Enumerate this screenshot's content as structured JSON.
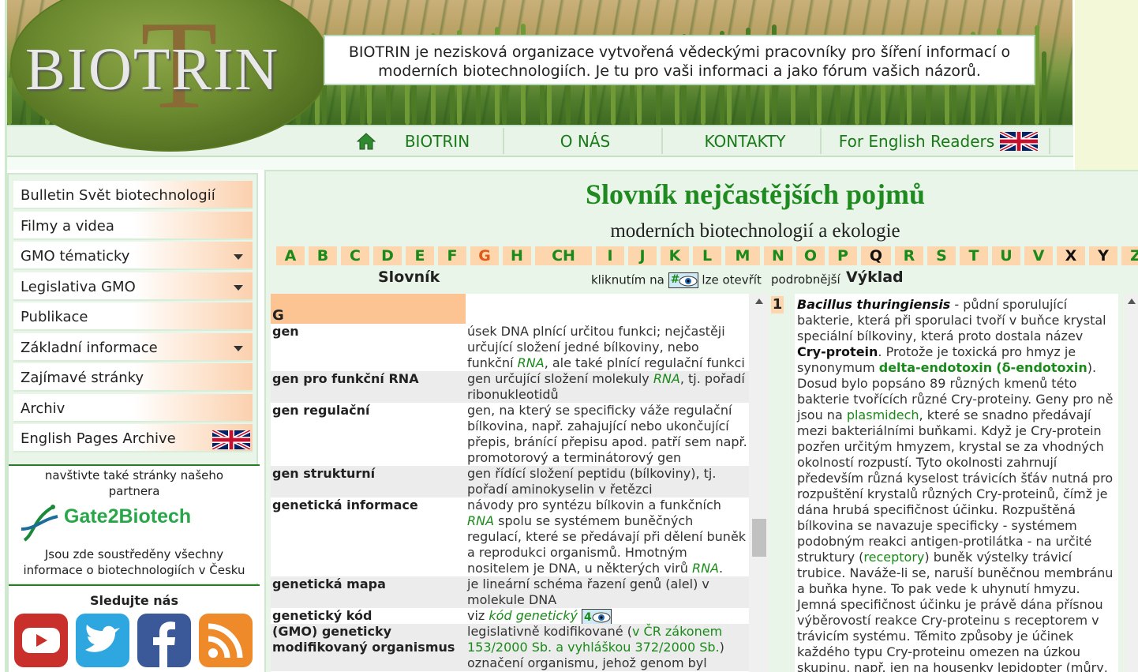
{
  "header": {
    "logo_text": "BIOTRIN",
    "intro": "BIOTRIN je nezisková organizace vytvořená vědeckými pracovníky pro šíření informací o moderních biotechnologiích. Je tu pro vaši informaci a jako fórum vašich názorů."
  },
  "nav": {
    "items": [
      {
        "label": "BIOTRIN",
        "icon": "home-icon"
      },
      {
        "label": "O NÁS"
      },
      {
        "label": "KONTAKTY"
      },
      {
        "label": "For English Readers",
        "icon": "uk-flag-icon"
      }
    ]
  },
  "sidebar": {
    "menu": [
      {
        "label": "Bulletin Svět biotechnologií",
        "has_submenu": false
      },
      {
        "label": "Filmy a videa",
        "has_submenu": false
      },
      {
        "label": "GMO tématicky",
        "has_submenu": true
      },
      {
        "label": "Legislativa GMO",
        "has_submenu": true
      },
      {
        "label": "Publikace",
        "has_submenu": false
      },
      {
        "label": "Základní informace",
        "has_submenu": true
      },
      {
        "label": "Zajímavé stránky",
        "has_submenu": false
      },
      {
        "label": "Archiv",
        "has_submenu": false
      },
      {
        "label": "English Pages Archive",
        "has_submenu": false,
        "icon": "uk-flag-icon"
      }
    ],
    "partner": {
      "intro": "navštivte také stránky našeho partnera",
      "logo_text": "Gate2Biotech",
      "outro": "Jsou zde soustředěny všechny informace o biotechnologiích v Česku"
    },
    "social": {
      "title": "Sledujte nás",
      "icons": [
        "youtube-icon",
        "twitter-icon",
        "facebook-icon",
        "rss-icon"
      ]
    }
  },
  "main": {
    "title": "Slovník nejčastějších pojmů",
    "subtitle": "moderních biotechnologií a ekologie",
    "alphabet": [
      "A",
      "B",
      "C",
      "D",
      "E",
      "F",
      "G",
      "H",
      "CH",
      "I",
      "J",
      "K",
      "L",
      "M",
      "N",
      "O",
      "P",
      "Q",
      "R",
      "S",
      "T",
      "U",
      "V",
      "X",
      "Y",
      "Z"
    ],
    "current_letter": "G",
    "dark_letters": [
      "Q",
      "X",
      "Y"
    ],
    "col_slovnik": "Slovník",
    "hint_pre": "kliknutím na",
    "hint_badge": "#",
    "hint_post": "lze otevřít",
    "hint_more": "podrobnější",
    "col_vyklad": "Výklad",
    "section_letter": "G",
    "entries": [
      {
        "term": "gen",
        "def": [
          "úsek DNA plnící určitou funkci; nejčastěji určující složení jedné bílkoviny, nebo funkční ",
          {
            "g": "RNA"
          },
          ", ale také plnící regulační funkci"
        ]
      },
      {
        "term": "gen pro funkční RNA",
        "def": [
          "gen určující složení molekuly ",
          {
            "g": "RNA"
          },
          ", tj. pořadí ribonukleotidů"
        ]
      },
      {
        "term": "gen regulační",
        "def": [
          "gen, na který se specificky váže regulační bílkovina, např. zahajující nebo ukončující přepis, bránící přepisu apod. patří sem např. promotorový a terminátorový gen"
        ]
      },
      {
        "term": "gen strukturní",
        "def": [
          "gen řídící složení peptidu (bílkoviny), tj. pořadí aminokyselin v řetězci"
        ]
      },
      {
        "term": "genetická informace",
        "def": [
          "návody pro syntézu bílkovin a funkčních ",
          {
            "g": "RNA"
          },
          " spolu se systémem buněčných regulací, které se předávají při dělení buněk a reprodukci organismů. Hmotným nositelem je DNA, u některých virů ",
          {
            "g": "RNA"
          },
          "."
        ]
      },
      {
        "term": "genetická mapa",
        "def": [
          "je lineární schéma řazení genů (alel) v molekule DNA"
        ]
      },
      {
        "term": "genetický kód",
        "def": [
          "viz ",
          {
            "g": "kód genetický"
          },
          " ",
          {
            "badge": "4"
          }
        ]
      },
      {
        "term": "(GMO) geneticky modifikovaný organismus",
        "def": [
          "legislativně kodifikované (",
          {
            "gn": "v ČR zákonem 153/2000 Sb. a vyhláškou 372/2000 Sb."
          },
          ") označení organismu, jehož genom byl"
        ]
      }
    ],
    "detail_number": "1",
    "detail": [
      {
        "bi": "Bacillus thuringiensis"
      },
      " - půdní sporulující bakterie, která při sporulaci tvoří v buňce krystal speciální bílkoviny, která proto dostala název ",
      {
        "b": "Cry-protein"
      },
      ". Protože je toxická pro hmyz je synonymum ",
      {
        "gb": "delta-endotoxin"
      },
      " ",
      {
        "gb": "(δ-endotoxin"
      },
      "). Dosud bylo popsáno 89 různých kmenů této bakterie tvořících různé Cry-proteiny. Geny pro ně jsou na ",
      {
        "gn": "plasmidech"
      },
      ", které se snadno předávají mezi bakteriálními buňkami. Když je Cry-protein pozřen určitým hmyzem, krystal se za vhodných okolností rozpustí. Tyto okolnosti zahrnují především různá kyselost trávicích šťáv nutná pro rozpuštění krystalů různých Cry-proteinů, čímž je dána hrubá specifičnost účinku. Rozpuštěná bílkovina se navazuje specificky - systémem podobným reakci antigen-protilátka - na určité struktury (",
      {
        "gn": "receptory"
      },
      ") buněk výstelky trávicí trubice. Naváže-li se, naruší buněčnou membránu a buňka hyne. To pak vede k uhynutí hmyzu. Jemná specifičnost účinku je právě dána přísnou výběrovostí reakce Cry-proteinu s receptorem v trávicím systému. Těmito způsoby je účinek každého typu Cry-proteinu omezen na úzkou skupinu, např. jen na housenky lepidopter (můry,"
    ]
  }
}
